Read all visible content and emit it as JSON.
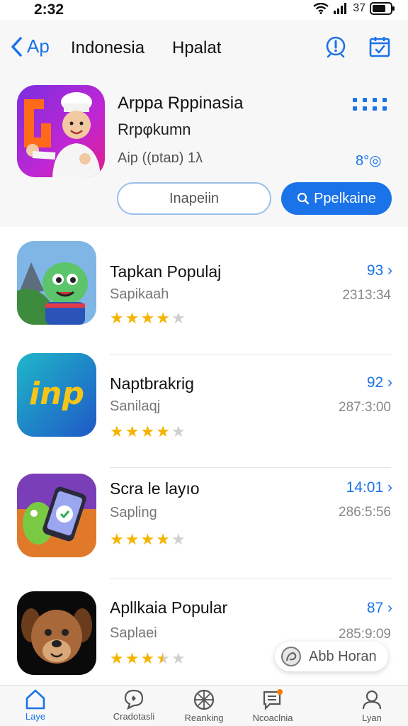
{
  "status": {
    "time": "2:32",
    "battery_text": "37"
  },
  "nav": {
    "back_label": "Ap",
    "title_1": "Indonesia",
    "title_2": "Hpalat"
  },
  "featured": {
    "title": "Arppa  Rppinasia",
    "subtitle": "Rrpφkumn",
    "meta": "Aip ((ɒtaɒ) 1λ",
    "right_meta": "8°◎",
    "btn_outline": "Inapeiin",
    "btn_primary": "Ppelkaine"
  },
  "apps": [
    {
      "title": "Tapkan Populaj",
      "subtitle": "Sapikaah",
      "rating": 4,
      "right": "93 ›",
      "time": "2313:34"
    },
    {
      "title": "Naptbrakrig",
      "subtitle": "Sanilaqj",
      "rating": 4,
      "right": "92 ›",
      "time": "287:3:00"
    },
    {
      "title": "Scra le layıo",
      "subtitle": "Sapling",
      "rating": 4,
      "right": "14:01 ›",
      "time": "286:5:56"
    },
    {
      "title": "Apllkaia Popular",
      "subtitle": "Saplaei",
      "rating": 3.5,
      "right": "87 ›",
      "time": "285:9:09"
    }
  ],
  "float_pill": {
    "label": "Abb Horan"
  },
  "tabs": [
    {
      "label": "Laye",
      "icon": "home-icon"
    },
    {
      "label": "Cradotasli",
      "icon": "chat-icon"
    },
    {
      "label": "Reanking",
      "icon": "compass-icon"
    },
    {
      "label": "Ncoaclnia",
      "icon": "news-icon"
    },
    {
      "label": "Lyan",
      "icon": "person-icon"
    }
  ],
  "colors": {
    "accent": "#1a73e8",
    "star": "#f4b400"
  }
}
